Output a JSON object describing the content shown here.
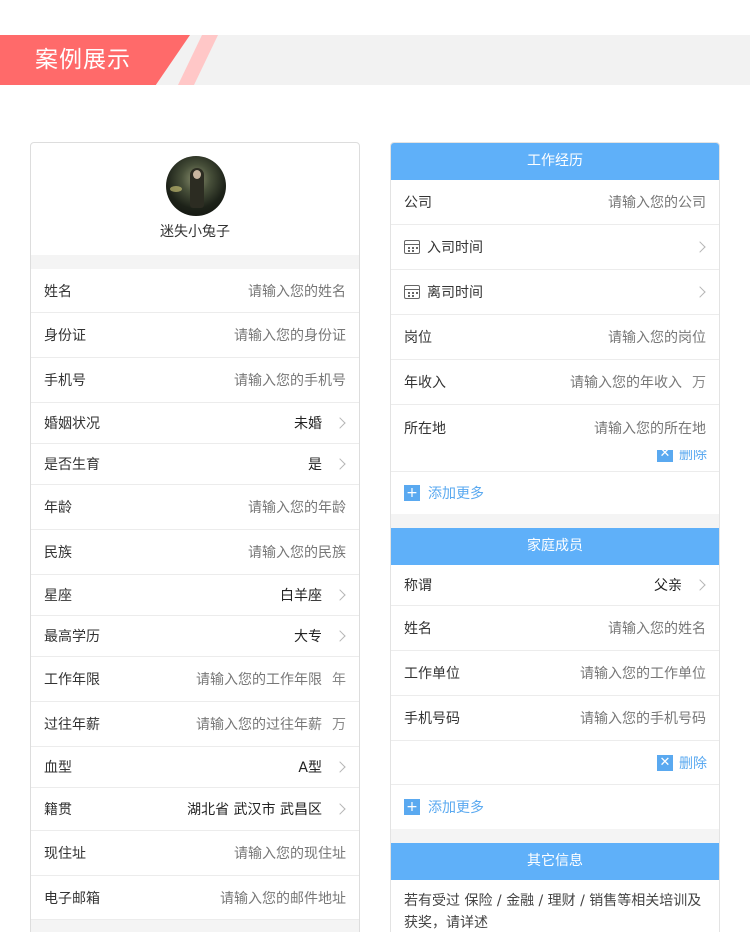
{
  "banner": {
    "title": "案例展示"
  },
  "profile": {
    "nickname": "迷失小兔子"
  },
  "personal": [
    {
      "label": "姓名",
      "value": "请输入您的姓名",
      "kind": "input"
    },
    {
      "label": "身份证",
      "value": "请输入您的身份证",
      "kind": "input"
    },
    {
      "label": "手机号",
      "value": "请输入您的手机号",
      "kind": "input"
    },
    {
      "label": "婚姻状况",
      "value": "未婚",
      "kind": "select"
    },
    {
      "label": "是否生育",
      "value": "是",
      "kind": "select"
    },
    {
      "label": "年龄",
      "value": "请输入您的年龄",
      "kind": "input"
    },
    {
      "label": "民族",
      "value": "请输入您的民族",
      "kind": "input"
    },
    {
      "label": "星座",
      "value": "白羊座",
      "kind": "select"
    },
    {
      "label": "最高学历",
      "value": "大专",
      "kind": "select"
    },
    {
      "label": "工作年限",
      "value": "请输入您的工作年限",
      "kind": "input",
      "unit": "年"
    },
    {
      "label": "过往年薪",
      "value": "请输入您的过往年薪",
      "kind": "input",
      "unit": "万"
    },
    {
      "label": "血型",
      "value": "A型",
      "kind": "select"
    },
    {
      "label": "籍贯",
      "value": "湖北省 武汉市 武昌区",
      "kind": "select"
    },
    {
      "label": "现住址",
      "value": "请输入您的现住址",
      "kind": "input"
    },
    {
      "label": "电子邮箱",
      "value": "请输入您的邮件地址",
      "kind": "input"
    }
  ],
  "work": {
    "title": "工作经历",
    "company": {
      "label": "公司",
      "value": "请输入您的公司"
    },
    "start": {
      "label": "入司时间"
    },
    "end": {
      "label": "离司时间"
    },
    "position": {
      "label": "岗位",
      "value": "请输入您的岗位"
    },
    "income": {
      "label": "年收入",
      "value": "请输入您的年收入",
      "unit": "万"
    },
    "location": {
      "label": "所在地",
      "value": "请输入您的所在地"
    },
    "delete_label": "删除",
    "add_label": "添加更多"
  },
  "family": {
    "title": "家庭成员",
    "relation": {
      "label": "称谓",
      "value": "父亲"
    },
    "name": {
      "label": "姓名",
      "value": "请输入您的姓名"
    },
    "employer": {
      "label": "工作单位",
      "value": "请输入您的工作单位"
    },
    "phone": {
      "label": "手机号码",
      "value": "请输入您的手机号码"
    },
    "delete_label": "删除",
    "add_label": "添加更多"
  },
  "other": {
    "title": "其它信息",
    "text": "若有受过 保险 / 金融 / 理财 / 销售等相关培训及获奖，请详述"
  },
  "colors": {
    "accent": "#5fb0f9",
    "banner_red": "#ff6a6a",
    "link": "#5aa9f0"
  }
}
